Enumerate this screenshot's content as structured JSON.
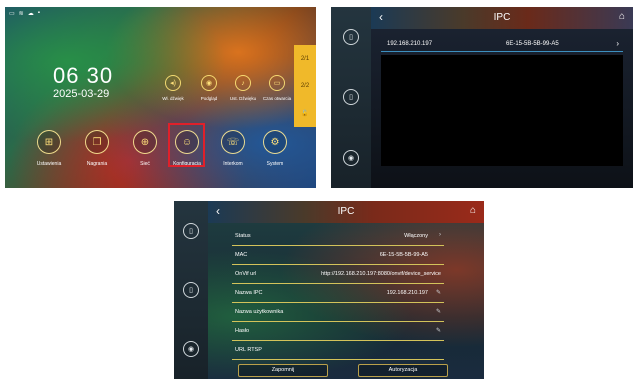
{
  "home": {
    "status_icons": [
      "tablet-icon",
      "wifi-icon",
      "cloud-icon",
      "sd-card-icon"
    ],
    "time": "06 30",
    "date": "2025-03-29",
    "quick_actions": [
      {
        "icon": "speaker-icon",
        "label": "Wł. dźwięk"
      },
      {
        "icon": "location-icon",
        "label": "Podgląd"
      },
      {
        "icon": "music-icon",
        "label": "Ust. Dźwięku"
      },
      {
        "icon": "monitor-icon",
        "label": "Czas otwarcia"
      }
    ],
    "side_buttons": [
      "2/1",
      "2/2"
    ],
    "menu": [
      {
        "icon": "grid-icon",
        "label": "Ustawienia"
      },
      {
        "icon": "book-icon",
        "label": "Nagrania"
      },
      {
        "icon": "globe-icon",
        "label": "Sieć"
      },
      {
        "icon": "user-icon",
        "label": "Konfiguracja"
      },
      {
        "icon": "intercom-icon",
        "label": "Interkom"
      },
      {
        "icon": "gear-icon",
        "label": "System"
      }
    ]
  },
  "ipc_list": {
    "title": "IPC",
    "items": [
      {
        "ip": "192.168.210.197",
        "mac": "6E-15-5B-5B-99-A5"
      }
    ]
  },
  "ipc_detail": {
    "title": "IPC",
    "rows": [
      {
        "label": "Status",
        "value": "Włączony",
        "action": "›"
      },
      {
        "label": "MAC",
        "value": "6E-15-5B-5B-99-A5",
        "action": ""
      },
      {
        "label": "OnVif url",
        "value": "http://192.168.210.197:8080/onvif/device_service",
        "action": ""
      },
      {
        "label": "Nazwa IPC",
        "value": "192.168.210.197",
        "action": "✎"
      },
      {
        "label": "Nazwa użytkownika",
        "value": "",
        "action": "✎"
      },
      {
        "label": "Hasło",
        "value": "",
        "action": "✎"
      },
      {
        "label": "URL RTSP",
        "value": "",
        "action": ""
      }
    ],
    "buttons": {
      "forget": "Zapomnij",
      "authorize": "Autoryzacja"
    }
  },
  "colors": {
    "accent_yellow": "#f0b92a",
    "highlight": "#e0202a",
    "divider": "#3c8fbf"
  }
}
